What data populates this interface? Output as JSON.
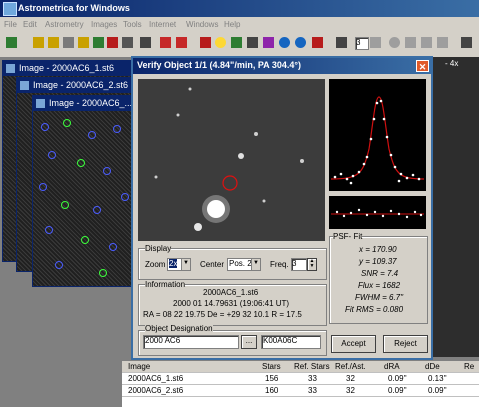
{
  "app": {
    "title": "Astrometrica for Windows"
  },
  "menu": [
    "File",
    "Edit",
    "Astrometry",
    "Images",
    "Tools",
    "Internet",
    "Windows",
    "Help"
  ],
  "toolbar": {
    "spin_value": "3"
  },
  "image_windows": [
    {
      "title": "Image - 2000AC6_1.st6"
    },
    {
      "title": "Image - 2000AC6_2.st6"
    },
    {
      "title": "Image - 2000AC6_..."
    }
  ],
  "right_window": {
    "caption_fragment": "- 4x"
  },
  "dialog": {
    "title": "Verify Object 1/1 (4.84\"/min, PA 304.4°)",
    "display": {
      "group_label": "Display",
      "zoom_label": "Zoom",
      "zoom_value": "2x",
      "center_label": "Center",
      "center_value": "Pos. 2",
      "freq_label": "Freq.",
      "freq_value": "3"
    },
    "information": {
      "group_label": "Information",
      "file": "2000AC6_1.st6",
      "datetime": "2000 01 14.79631 (19:06:41 UT)",
      "coords": "RA = 08 22 19.75   De = +29 32 10.1   R = 17.5"
    },
    "designation": {
      "group_label": "Object Designation",
      "value": "2000 AC6",
      "browse": "...",
      "code": "K00A06C"
    },
    "psf": {
      "group_label": "PSF- Fit",
      "x": "x = 170.90",
      "y": "y = 109.37",
      "snr": "SNR = 7.4",
      "flux": "Flux = 1682",
      "fwhm": "FWHM = 6.7''",
      "rms": "Fit RMS = 0.080"
    },
    "accept": "Accept",
    "reject": "Reject"
  },
  "table": {
    "headers": [
      "Image",
      "Stars",
      "Ref. Stars",
      "Ref./Ast.",
      "dRA",
      "dDe",
      "Re"
    ],
    "rows": [
      [
        "2000AC6_1.st6",
        "156",
        "33",
        "32",
        "0.09''",
        "0.13''",
        ""
      ],
      [
        "2000AC6_2.st6",
        "160",
        "33",
        "32",
        "0.09''",
        "0.09''",
        ""
      ]
    ]
  }
}
